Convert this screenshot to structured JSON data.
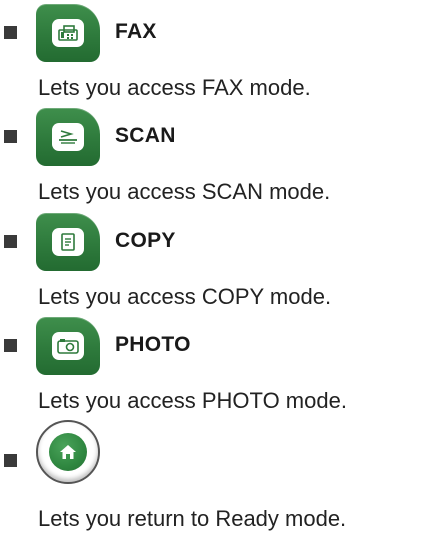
{
  "items": [
    {
      "icon": "fax-icon",
      "label": "FAX",
      "description": "Lets you access FAX mode."
    },
    {
      "icon": "scan-icon",
      "label": "SCAN",
      "description": "Lets you access SCAN mode."
    },
    {
      "icon": "copy-icon",
      "label": "COPY",
      "description": "Lets you access COPY mode."
    },
    {
      "icon": "photo-icon",
      "label": "PHOTO",
      "description": "Lets you access PHOTO mode."
    }
  ],
  "home": {
    "icon": "home-icon",
    "description": "Lets you return to Ready mode."
  },
  "colors": {
    "button_green": "#2e7a3c",
    "bullet": "#3a3a3a"
  }
}
